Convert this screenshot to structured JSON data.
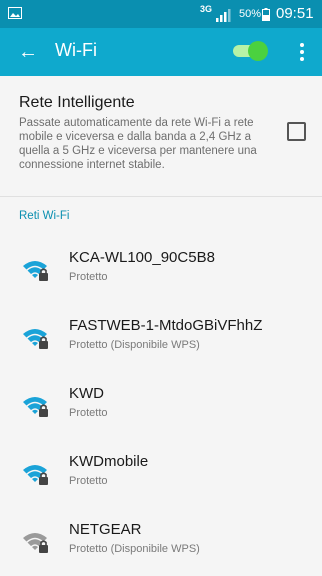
{
  "status_bar": {
    "network": "3G",
    "battery": "50%",
    "time": "09:51",
    "left_icon": "image-notification-icon",
    "signal_icon": "signal-icon",
    "battery_icon": "battery-icon"
  },
  "app_bar": {
    "title": "Wi-Fi",
    "back_icon": "←",
    "toggle_on": true,
    "accent": "#0fa9cd",
    "toggle_color": "#4bd13f"
  },
  "smart_network": {
    "label": "Rete Intelligente",
    "description": "Passate automaticamente da rete Wi-Fi a rete mobile e viceversa e dalla banda a 2,4 GHz a quella a 5 GHz e viceversa per mantenere una connessione internet stabile.",
    "checked": false
  },
  "section_title": "Reti Wi-Fi",
  "networks": [
    {
      "ssid": "KCA-WL100_90C5B8",
      "status": "Protetto",
      "signal_color": "#1aa3d8"
    },
    {
      "ssid": "FASTWEB-1-MtdoGBiVFhhZ",
      "status": "Protetto (Disponibile WPS)",
      "signal_color": "#1aa3d8"
    },
    {
      "ssid": "KWD",
      "status": "Protetto",
      "signal_color": "#1aa3d8"
    },
    {
      "ssid": "KWDmobile",
      "status": "Protetto",
      "signal_color": "#1aa3d8"
    },
    {
      "ssid": "NETGEAR",
      "status": "Protetto (Disponibile WPS)",
      "signal_color": "#9a9a9a"
    }
  ]
}
